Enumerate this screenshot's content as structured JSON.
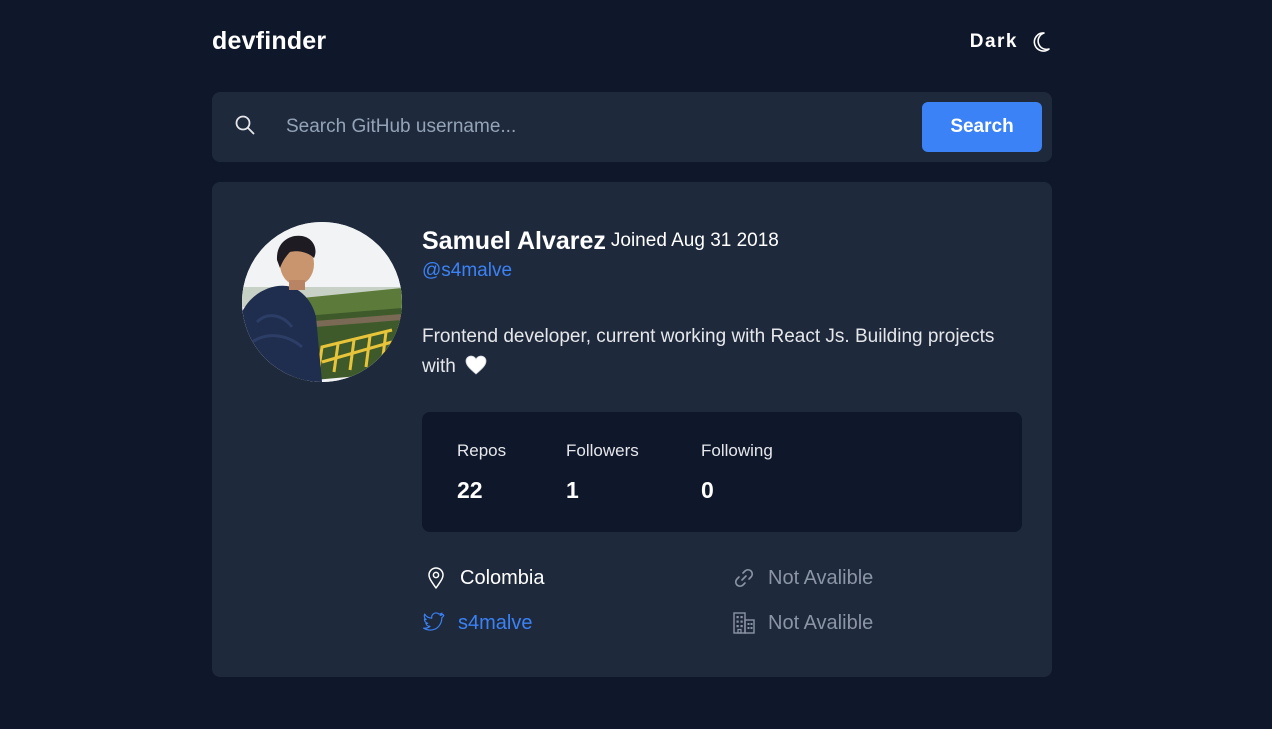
{
  "header": {
    "logo": "devfinder",
    "theme_label": "Dark",
    "theme_icon": "moon-icon"
  },
  "search": {
    "placeholder": "Search GitHub username...",
    "value": "",
    "button_label": "Search",
    "icon": "search-icon"
  },
  "profile": {
    "name": "Samuel Alvarez",
    "joined": "Joined Aug 31 2018",
    "username": "@s4malve",
    "bio": "Frontend developer, current working with React Js. Building projects with",
    "bio_icon": "heart-icon",
    "avatar_icon": "avatar"
  },
  "stats": [
    {
      "label": "Repos",
      "value": "22"
    },
    {
      "label": "Followers",
      "value": "1"
    },
    {
      "label": "Following",
      "value": "0"
    }
  ],
  "links": {
    "location": {
      "icon": "location-pin-icon",
      "text": "Colombia"
    },
    "blog": {
      "icon": "link-icon",
      "text": "Not Avalible"
    },
    "twitter": {
      "icon": "twitter-icon",
      "text": "s4malve"
    },
    "company": {
      "icon": "building-icon",
      "text": "Not Avalible"
    }
  },
  "colors": {
    "background": "#0f172a",
    "card": "#1e293b",
    "accent": "#3b82f6",
    "muted": "#8b95a5"
  }
}
